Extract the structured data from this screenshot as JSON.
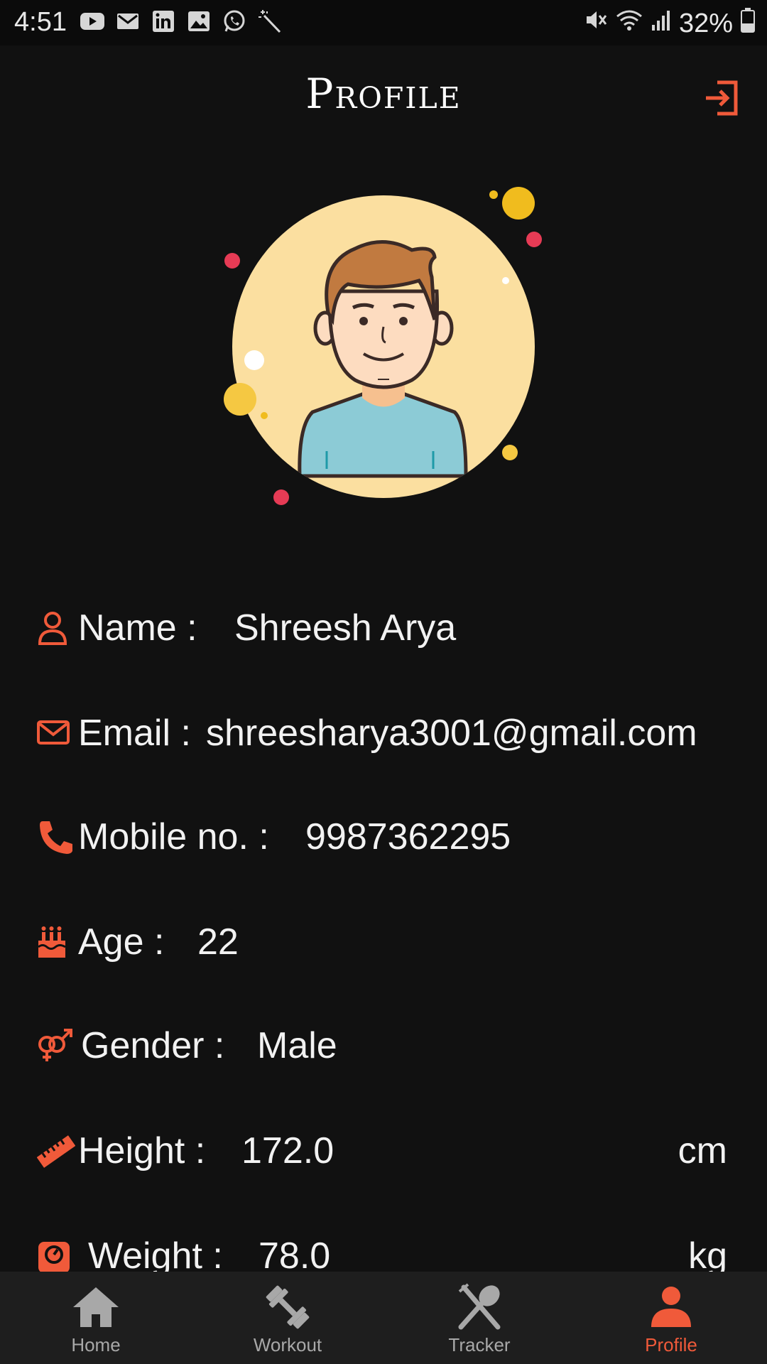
{
  "status_bar": {
    "time": "4:51",
    "battery": "32%",
    "left_icons": [
      "youtube-icon",
      "gmail-icon",
      "linkedin-icon",
      "gallery-icon",
      "whatsapp-icon",
      "magic-wand-icon"
    ],
    "right_icons": [
      "mute-icon",
      "wifi-icon",
      "signal-icon",
      "battery-icon"
    ]
  },
  "header": {
    "title": "Profile",
    "action_icon": "logout-icon"
  },
  "colors": {
    "accent": "#f05a3a",
    "background": "#111111",
    "nav_background": "#1e1e1e",
    "avatar_circle": "#fbdfa0"
  },
  "profile": {
    "name": {
      "label": "Name :",
      "value": "Shreesh Arya",
      "icon": "user-icon"
    },
    "email": {
      "label": "Email :",
      "value": "shreesharya3001@gmail.com",
      "icon": "mail-icon"
    },
    "mobile": {
      "label": "Mobile no. :",
      "value": "9987362295",
      "icon": "phone-icon"
    },
    "age": {
      "label": "Age :",
      "value": "22",
      "icon": "birthday-cake-icon"
    },
    "gender": {
      "label": "Gender :",
      "value": "Male",
      "icon": "gender-icon"
    },
    "height": {
      "label": "Height :",
      "value": "172.0",
      "unit": "cm",
      "icon": "ruler-icon"
    },
    "weight": {
      "label": "Weight :",
      "value": "78.0",
      "unit": "kg",
      "icon": "weighing-scale-icon"
    }
  },
  "bottom_nav": {
    "items": [
      {
        "label": "Home",
        "icon": "home-icon",
        "active": false
      },
      {
        "label": "Workout",
        "icon": "dumbbell-icon",
        "active": false
      },
      {
        "label": "Tracker",
        "icon": "fork-spoon-icon",
        "active": false
      },
      {
        "label": "Profile",
        "icon": "person-icon",
        "active": true
      }
    ]
  }
}
